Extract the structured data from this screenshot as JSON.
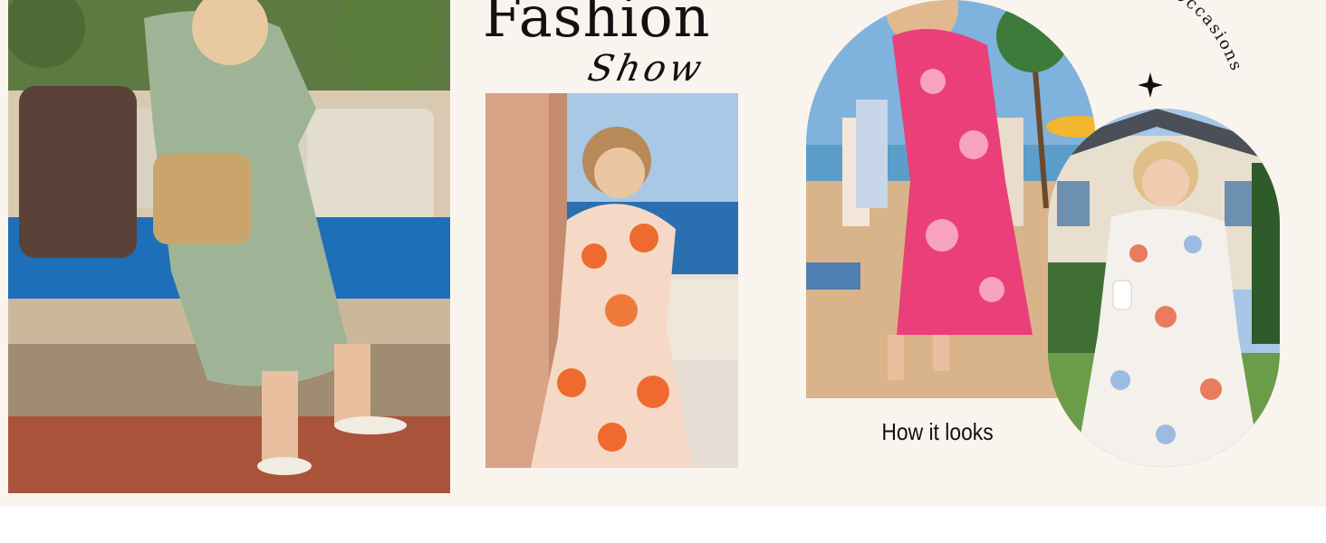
{
  "banner": {
    "title": "Fashion",
    "script_word": "Show",
    "caption": "How it looks",
    "arc_text": "g Occasions",
    "colors": {
      "background": "#faf4ee",
      "text": "#111111"
    }
  },
  "icons": {
    "sparkle": "four-point-star-icon"
  }
}
